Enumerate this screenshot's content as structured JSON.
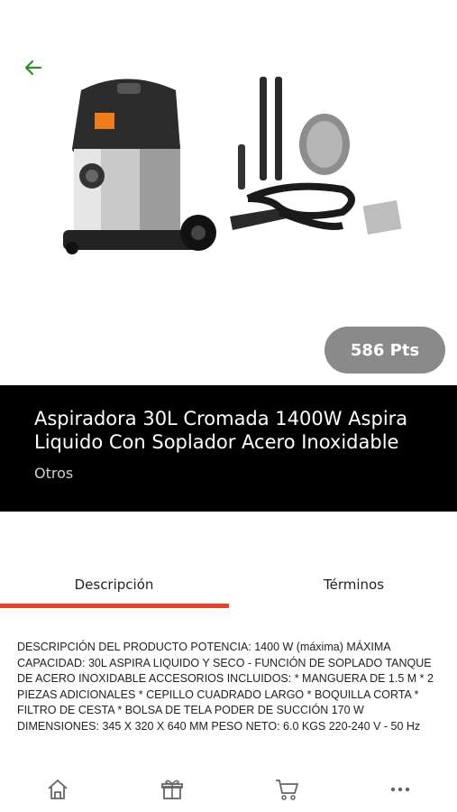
{
  "colors": {
    "accent": "#e4442b",
    "back_arrow": "#2e8b2e",
    "badge_bg": "#8a8a8a",
    "title_bg": "#000000"
  },
  "header": {
    "back_icon": "arrow-left-icon"
  },
  "product": {
    "image_alt_icon": "vacuum-cleaner-with-accessories",
    "points": "586 Pts",
    "title": "Aspiradora 30L Cromada 1400W Aspira Liquido Con Soplador Acero Inoxidable",
    "category": "Otros"
  },
  "tabs": [
    {
      "label": "Descripción",
      "active": true
    },
    {
      "label": "Términos",
      "active": false
    }
  ],
  "description": "DESCRIPCIÓN DEL PRODUCTO POTENCIA: 1400 W (máxima) MÁXIMA CAPACIDAD: 30L ASPIRA LIQUIDO Y SECO - FUNCIÓN DE SOPLADO TANQUE DE ACERO INOXIDABLE ACCESORIOS INCLUIDOS: * MANGUERA DE 1.5 M * 2 PIEZAS ADICIONALES * CEPILLO CUADRADO LARGO * BOQUILLA CORTA * FILTRO DE CESTA * BOLSA DE TELA PODER DE SUCCIÓN 170 W DIMENSIONES: 345 X 320 X 640 MM PESO NETO: 6.0 KGS 220-240 V - 50 Hz",
  "bottom_nav": {
    "items": [
      "home-icon",
      "gift-icon",
      "cart-icon",
      "more-icon"
    ]
  }
}
